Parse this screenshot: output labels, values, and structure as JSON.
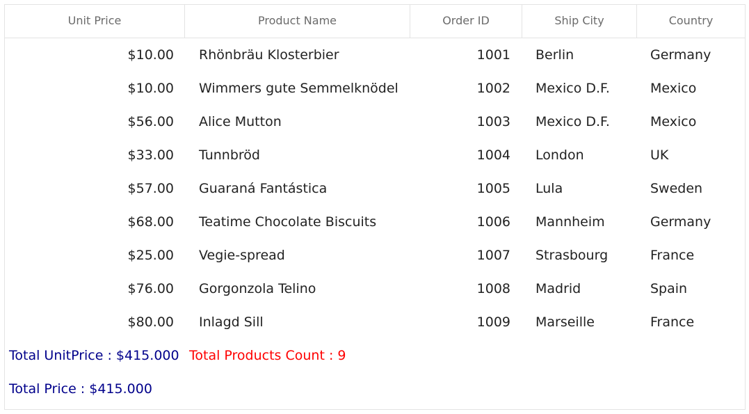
{
  "grid": {
    "columns": [
      "Unit Price",
      "Product Name",
      "Order ID",
      "Ship City",
      "Country"
    ],
    "rows": [
      [
        "$10.00",
        "Rhönbräu Klosterbier",
        "1001",
        "Berlin",
        "Germany"
      ],
      [
        "$10.00",
        "Wimmers gute Semmelknödel",
        "1002",
        "Mexico D.F.",
        "Mexico"
      ],
      [
        "$56.00",
        "Alice Mutton",
        "1003",
        "Mexico D.F.",
        "Mexico"
      ],
      [
        "$33.00",
        "Tunnbröd",
        "1004",
        "London",
        "UK"
      ],
      [
        "$57.00",
        "Guaraná Fantástica",
        "1005",
        "Lula",
        "Sweden"
      ],
      [
        "$68.00",
        "Teatime Chocolate Biscuits",
        "1006",
        "Mannheim",
        "Germany"
      ],
      [
        "$25.00",
        "Vegie-spread",
        "1007",
        "Strasbourg",
        "France"
      ],
      [
        "$76.00",
        "Gorgonzola Telino",
        "1008",
        "Madrid",
        "Spain"
      ],
      [
        "$80.00",
        "Inlagd Sill",
        "1009",
        "Marseille",
        "France"
      ]
    ]
  },
  "summary": {
    "total_unit_price": "Total UnitPrice : $415.000",
    "total_products_count": "Total Products Count : 9",
    "total_price": "Total Price :  $415.000"
  },
  "colors": {
    "summary_text": "#00008b",
    "count_text": "#ff0000",
    "header_text": "#6b6b6b",
    "border": "#e3e3e3"
  }
}
